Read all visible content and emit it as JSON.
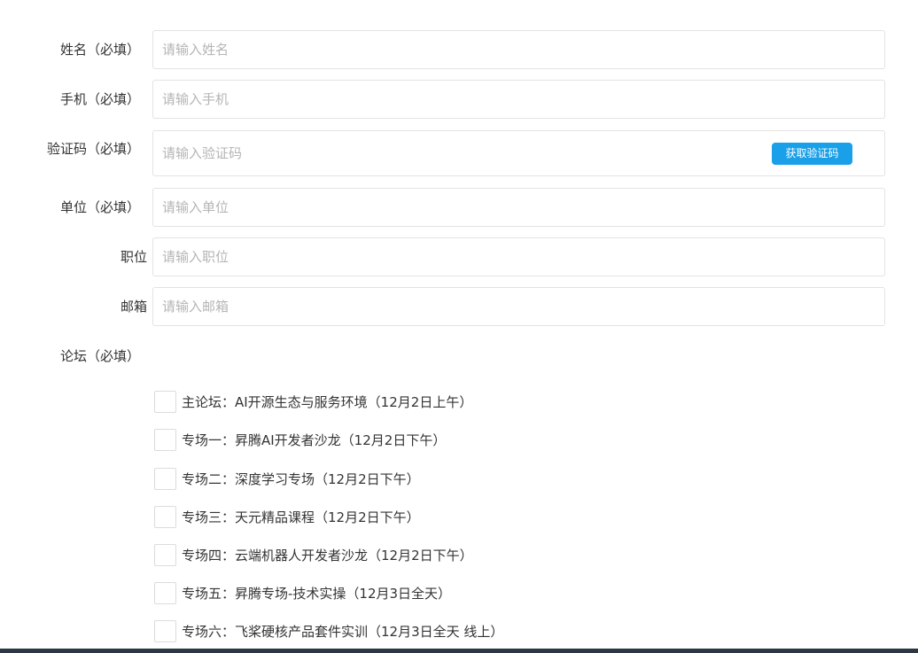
{
  "form": {
    "fields": [
      {
        "label": "姓名（必填）",
        "placeholder": "请输入姓名"
      },
      {
        "label": "手机（必填）",
        "placeholder": "请输入手机"
      },
      {
        "label": "验证码（必填）",
        "placeholder": "请输入验证码"
      },
      {
        "label": "单位（必填）",
        "placeholder": "请输入单位"
      },
      {
        "label": "职位",
        "placeholder": "请输入职位"
      },
      {
        "label": "邮箱",
        "placeholder": "请输入邮箱"
      }
    ],
    "get_code_label": "获取验证码",
    "forum_label": "论坛（必填）",
    "forum_options": [
      {
        "label": "主论坛：AI开源生态与服务环境（12月2日上午）",
        "checked": false
      },
      {
        "label": "专场一：昇腾AI开发者沙龙（12月2日下午）",
        "checked": false
      },
      {
        "label": "专场二：深度学习专场（12月2日下午）",
        "checked": false
      },
      {
        "label": "专场三：天元精品课程（12月2日下午）",
        "checked": false
      },
      {
        "label": "专场四：云端机器人开发者沙龙（12月2日下午）",
        "checked": false
      },
      {
        "label": "专场五：昇腾专场-技术实操（12月3日全天）",
        "checked": false
      },
      {
        "label": "专场六：飞桨硬核产品套件实训（12月3日全天 线上）",
        "checked": false
      }
    ]
  },
  "colors": {
    "accent": "#1aa0e8",
    "border": "#e3e3e3",
    "placeholder": "#b5b5b5",
    "bottom_bar": "#2b3742"
  }
}
